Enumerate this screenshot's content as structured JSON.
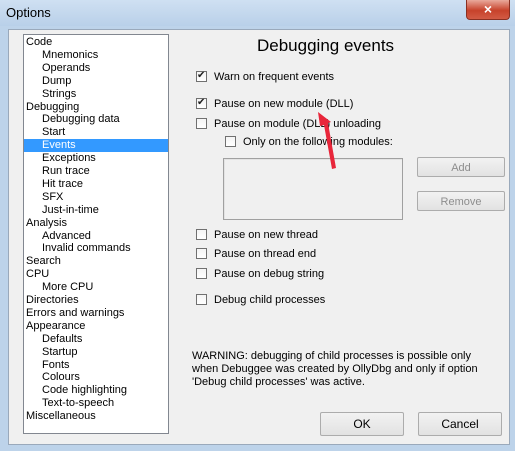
{
  "window": {
    "title": "Options",
    "close_icon": "×"
  },
  "tree": [
    {
      "label": "Code",
      "level": 0
    },
    {
      "label": "Mnemonics",
      "level": 1
    },
    {
      "label": "Operands",
      "level": 1
    },
    {
      "label": "Dump",
      "level": 1
    },
    {
      "label": "Strings",
      "level": 1
    },
    {
      "label": "Debugging",
      "level": 0
    },
    {
      "label": "Debugging data",
      "level": 1
    },
    {
      "label": "Start",
      "level": 1
    },
    {
      "label": "Events",
      "level": 1,
      "selected": true
    },
    {
      "label": "Exceptions",
      "level": 1
    },
    {
      "label": "Run trace",
      "level": 1
    },
    {
      "label": "Hit trace",
      "level": 1
    },
    {
      "label": "SFX",
      "level": 1
    },
    {
      "label": "Just-in-time",
      "level": 1
    },
    {
      "label": "Analysis",
      "level": 0
    },
    {
      "label": "Advanced",
      "level": 1
    },
    {
      "label": "Invalid commands",
      "level": 1
    },
    {
      "label": "Search",
      "level": 0
    },
    {
      "label": "CPU",
      "level": 0
    },
    {
      "label": "More CPU",
      "level": 1
    },
    {
      "label": "Directories",
      "level": 0
    },
    {
      "label": "Errors and warnings",
      "level": 0
    },
    {
      "label": "Appearance",
      "level": 0
    },
    {
      "label": "Defaults",
      "level": 1
    },
    {
      "label": "Startup",
      "level": 1
    },
    {
      "label": "Fonts",
      "level": 1
    },
    {
      "label": "Colours",
      "level": 1
    },
    {
      "label": "Code highlighting",
      "level": 1
    },
    {
      "label": "Text-to-speech",
      "level": 1
    },
    {
      "label": "Miscellaneous",
      "level": 0
    }
  ],
  "panel": {
    "heading": "Debugging events",
    "options": [
      {
        "label": "Warn on frequent events",
        "checked": true
      },
      {
        "label": "Pause on new module (DLL)",
        "checked": true
      },
      {
        "label": "Pause on module (DLL) unloading",
        "checked": false
      },
      {
        "label": "Only on the following modules:",
        "checked": false
      },
      {
        "label": "Pause on new thread",
        "checked": false
      },
      {
        "label": "Pause on thread end",
        "checked": false
      },
      {
        "label": "Pause on debug string",
        "checked": false
      },
      {
        "label": "Debug child processes",
        "checked": false
      }
    ],
    "add_label": "Add",
    "remove_label": "Remove",
    "warning_lines": [
      "WARNING: debugging of child processes is possible only",
      "when Debuggee was created by OllyDbg and only if option",
      "'Debug child processes' was active."
    ]
  },
  "footer": {
    "ok_label": "OK",
    "cancel_label": "Cancel"
  },
  "colors": {
    "selection": "#3399ff",
    "arrow": "#e8263a"
  }
}
